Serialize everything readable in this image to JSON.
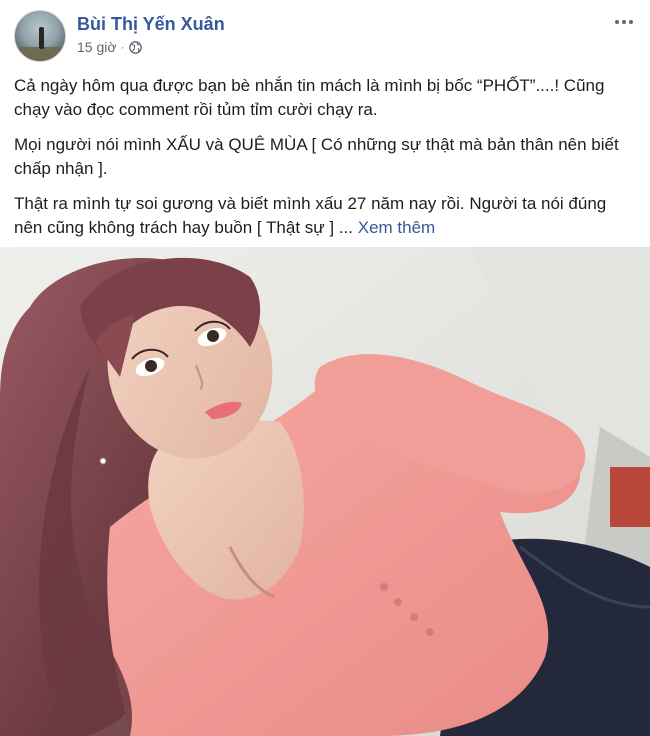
{
  "post": {
    "author": "Bùi Thị Yến Xuân",
    "time": "15 giờ",
    "dot": "·",
    "privacy_icon": "globe-icon",
    "more_icon": "more-options-icon",
    "paragraphs": [
      "Cả ngày hôm qua được bạn bè nhắn tin mách là mình bị bốc “PHỐT”....! Cũng chạy vào đọc comment rồi tủm tỉm cười chạy ra.",
      "Mọi người nói mình XẤU và QUÊ MÙA [ Có những sự thật mà bản thân nên biết chấp nhận ].",
      "Thật ra mình tự soi gương và biết mình xấu 27 năm nay rồi. Người ta nói đúng nên cũng không trách hay buồn [ Thật sự ] ..."
    ],
    "see_more": "Xem thêm",
    "colors": {
      "link": "#385898",
      "text": "#1c1e21",
      "meta": "#616770"
    }
  }
}
